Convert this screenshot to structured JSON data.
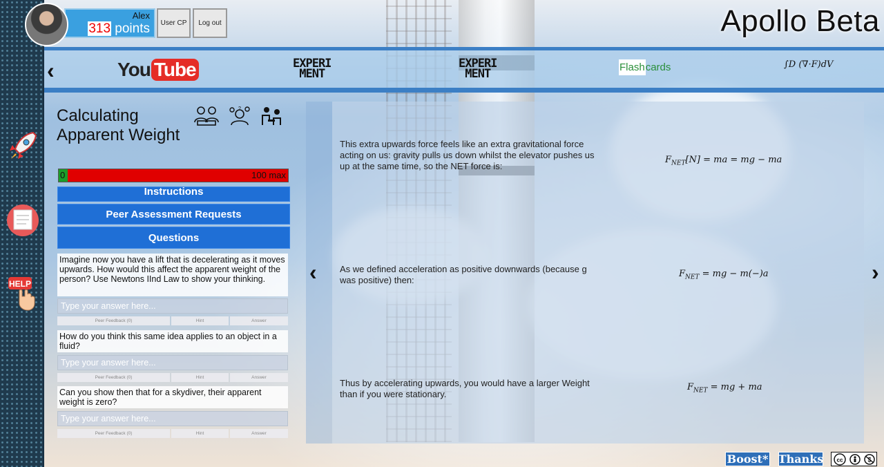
{
  "header": {
    "username": "Alex",
    "points_value": "313",
    "points_label": " points",
    "user_cp_label": "User CP",
    "logout_label": "Log out",
    "app_title": "Apollo Beta"
  },
  "nav": {
    "youtube_you": "You",
    "youtube_tube": "Tube",
    "experiment_1": "EXPERI\nMENT",
    "experiment_2": "EXPERI\nMENT",
    "flashcards_hl": "Flash",
    "flashcards_rest": "cards",
    "integral": "∫D (∇·F)dV"
  },
  "lesson": {
    "title": "Calculating Apparent Weight",
    "progress_min": "0",
    "progress_max": "100 max",
    "progress_fraction": 0.04,
    "buttons": {
      "instructions": "Instructions",
      "peer": "Peer Assessment Requests",
      "questions": "Questions"
    },
    "questions": [
      {
        "text": "Imagine now you have a lift that is decelerating as it moves upwards. How would this affect the apparent weight of the person? Use Newtons IInd Law to show your thinking.",
        "placeholder": "Type your answer here...",
        "feedback": "Peer Feedback (0)",
        "hint": "Hint",
        "answer": "Answer"
      },
      {
        "text": "How do you think this same idea applies to an object in a fluid?",
        "placeholder": "Type your answer here...",
        "feedback": "Peer Feedback (0)",
        "hint": "Hint",
        "answer": "Answer"
      },
      {
        "text": "Can you show then that for a skydiver, their apparent weight is zero?",
        "placeholder": "Type your answer here...",
        "feedback": "Peer Feedback (0)",
        "hint": "Hint",
        "answer": "Answer"
      }
    ]
  },
  "slide": {
    "text1": "This extra upwards force feels like an extra gravitational force acting on us: gravity pulls us down whilst the elevator pushes us up at the same time, so the NET force is:",
    "formula1": "F_NET[N] = ma = mg − ma",
    "text2": "As we defined acceleration as positive downwards (because g was positive) then:",
    "formula2": "F_NET = mg − m(−)a",
    "text3": "Thus by accelerating upwards, you would have a larger Weight than if you were stationary.",
    "formula3": "F_NET = mg + ma"
  },
  "footer": {
    "boost_label": "Boost*",
    "thanks_label": "Thanks",
    "cc_label": "cc by nc"
  },
  "icons": {
    "side": [
      "rocket-icon",
      "notes-icon",
      "help-icon"
    ],
    "modes": [
      "group-icon",
      "discussion-icon",
      "tutoring-icon"
    ]
  }
}
